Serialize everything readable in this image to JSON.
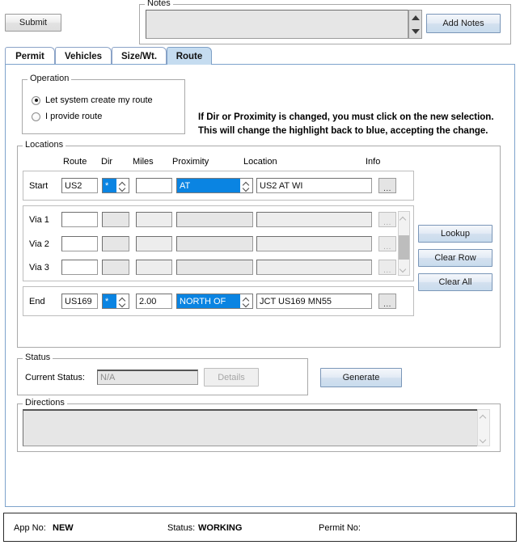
{
  "toolbar": {
    "submit_label": "Submit",
    "add_notes_label": "Add Notes",
    "notes_legend": "Notes",
    "notes_value": ""
  },
  "tabs": [
    {
      "label": "Permit",
      "active": false
    },
    {
      "label": "Vehicles",
      "active": false
    },
    {
      "label": "Size/Wt.",
      "active": false
    },
    {
      "label": "Route",
      "active": true
    }
  ],
  "operation": {
    "legend": "Operation",
    "options": [
      {
        "label": "Let system create my route",
        "selected": true
      },
      {
        "label": "I provide route",
        "selected": false
      }
    ]
  },
  "warning": {
    "line1": "If Dir or Proximity is changed, you must click on the new selection.",
    "line2": "This will change the highlight back to blue, accepting the change."
  },
  "locations": {
    "legend": "Locations",
    "headers": {
      "route": "Route",
      "dir": "Dir",
      "miles": "Miles",
      "proximity": "Proximity",
      "location": "Location",
      "info": "Info"
    },
    "start": {
      "label": "Start",
      "route": "US2",
      "dir": "*",
      "miles": "",
      "proximity": "AT",
      "location": "US2 AT WI",
      "info": "..."
    },
    "via": [
      {
        "label": "Via 1",
        "route": "",
        "dir": "",
        "miles": "",
        "proximity": "",
        "location": "",
        "info": "..."
      },
      {
        "label": "Via 2",
        "route": "",
        "dir": "",
        "miles": "",
        "proximity": "",
        "location": "",
        "info": "..."
      },
      {
        "label": "Via 3",
        "route": "",
        "dir": "",
        "miles": "",
        "proximity": "",
        "location": "",
        "info": "..."
      }
    ],
    "end": {
      "label": "End",
      "route": "US169",
      "dir": "*",
      "miles": "2.00",
      "proximity": "NORTH OF",
      "location": "JCT US169 MN55",
      "info": "..."
    },
    "side_buttons": [
      {
        "label": "Lookup"
      },
      {
        "label": "Clear Row"
      },
      {
        "label": "Clear All"
      }
    ]
  },
  "status": {
    "legend": "Status",
    "current_status_label": "Current Status:",
    "current_status_value": "N/A",
    "details_label": "Details",
    "generate_label": "Generate"
  },
  "directions": {
    "legend": "Directions",
    "value": ""
  },
  "footer": {
    "app_no_label": "App No:",
    "app_no_value": "NEW",
    "status_label": "Status:",
    "status_value": "WORKING",
    "permit_no_label": "Permit No:",
    "permit_no_value": ""
  },
  "colors": {
    "selection_blue": "#0a84e2",
    "active_tab": "#c5dcf0",
    "panel_border": "#7ea3cc"
  }
}
